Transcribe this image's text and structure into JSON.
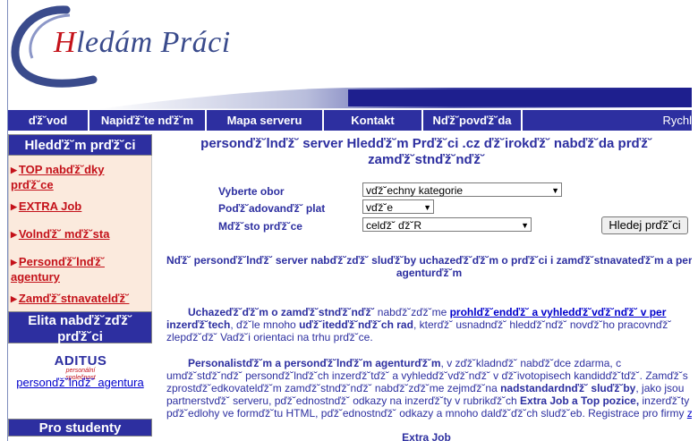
{
  "header": {
    "logo_first": "H",
    "logo_rest": "ledám Práci"
  },
  "nav": {
    "items": [
      "ďž˘vod",
      "Napiďž˘te nďž˘m",
      "Mapa serveru",
      "Kontakt",
      "Nďž˘povďž˘da",
      "Rychl"
    ]
  },
  "sidebar": {
    "heading": "Hledďž˘m prďž˘ci",
    "links": [
      "TOP nabďž˘dky prďž˘ce",
      "EXTRA Job",
      "Volnďž˘ mďž˘sta",
      "Personďž˘lnďž˘ agentury",
      "Zamďž˘stnavatelďž˘"
    ],
    "elita_heading": "Elita nabďž˘zďž˘ prďž˘ci",
    "aditus_word": "ADITUS",
    "aditus_sub": "personální společnost",
    "aditus_link": "personďž˘lnďž˘ agentura",
    "students_heading": "Pro studenty"
  },
  "main": {
    "title_line1": "personďž˘lnďž˘ server Hledďž˘m Prďž˘ci .cz ďž˘irokďž˘ nabďž˘da prďž˘",
    "title_line2": "zamďž˘stnďž˘nďž˘",
    "form": {
      "category_label": "Vyberte obor",
      "category_value": "vďž˘echny kategorie",
      "salary_label": "Poďž˘adovanďž˘ plat",
      "salary_value": "vďž˘e",
      "place_label": "Mďž˘sto prďž˘ce",
      "place_value": "celďž˘ ďž˘R",
      "search_button": "Hledej prďž˘ci"
    },
    "intro_line1": "Nďž˘ personďž˘lnďž˘ server nabďž˘zďž˘ sluďž˘by uchazeďž˘ďž˘m o prďž˘ci i zamďž˘stnavateďž˘m a per",
    "intro_line2": "agenturďž˘m",
    "p1": {
      "a": "Uchazeďž˘ďž˘m o zamďž˘stnďž˘nďž˘",
      "b": " nabďž˘zďž˘me ",
      "c": "prohlďž˘endďž˘ a vyhledďž˘vďž˘nďž˘ v per",
      "d": "inzerďž˘tech",
      "e": ", ďž˘le mnoho ",
      "f": "uďž˘itedďž˘nďž˘ch rad",
      "g": ", kterďž˘ usnadnďž˘ hledďž˘nďž˘ novďž˘ho pracovnďž˘",
      "h": "zlepďž˘ďž˘ Vaďž˘i orientaci na trhu prďž˘ce."
    },
    "p2": {
      "a": "Personalistďž˘m a personďž˘lnďž˘m agenturďž˘m",
      "b": ", v zďž˘kladnďž˘ nabďž˘dce zdarma, c",
      "c": "umďž˘stďž˘nďž˘ personďž˘lnďž˘ch inzerďž˘tďž˘ a vyhledďž˘vďž˘nďž˘ v ďž˘ivotopisech kandidďž˘tďž˘. Zamďž˘s",
      "d": "zprostďž˘edkovatelďž˘m zamďž˘stnďž˘nďž˘ nabďž˘zďž˘me zejmďž˘na ",
      "e": "nadstandardnďž˘ sluďž˘by",
      "f": ", jako jsou",
      "g": "partnerstvďž˘ serveru, pďž˘ednostnďž˘ odkazy na inzerďž˘ty v rubrikďž˘ch ",
      "h": "Extra Job a Top pozice,",
      "i": " inzerďž˘ty",
      "j": "pďž˘edlohy ve formďž˘tu HTML, pďž˘ednostnďž˘ odkazy a mnoho dalďž˘ďž˘ch sluďž˘eb. Registrace pro firmy ",
      "k": "z"
    },
    "extra_job": "Extra Job"
  },
  "colors": {
    "nav_blue": "#2d2fa0",
    "accent_red": "#c4121a",
    "side_bg": "#fbeadd"
  }
}
